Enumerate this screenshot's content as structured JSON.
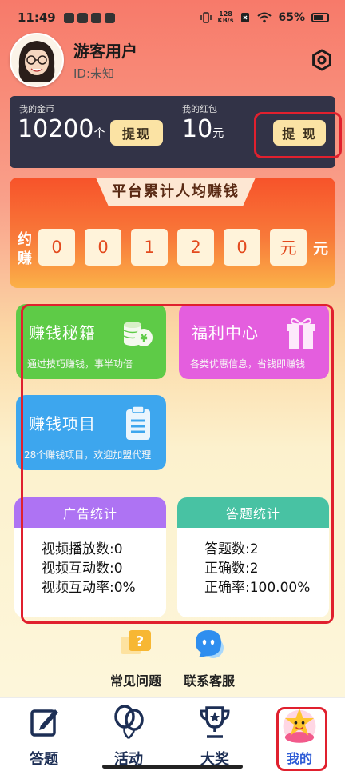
{
  "status_bar": {
    "time": "11:49",
    "net_speed_value": "128",
    "net_speed_unit": "KB/s",
    "battery": "65%"
  },
  "profile": {
    "username": "游客用户",
    "user_id": "ID:未知"
  },
  "wallet": {
    "coins_label": "我的金币",
    "coins_amount": "10200",
    "coins_unit": "个",
    "coins_withdraw": "提现",
    "redpacket_label": "我的红包",
    "redpacket_amount": "10",
    "redpacket_unit": "元",
    "redpacket_withdraw": "提 现"
  },
  "earnings": {
    "title": "平台累计人均赚钱",
    "side_label_1": "约",
    "side_label_2": "赚",
    "digits": [
      "0",
      "0",
      "1",
      "2",
      "0",
      "元"
    ],
    "tail": "元"
  },
  "tiles": {
    "earn_tips": {
      "title": "赚钱秘籍",
      "subtitle": "通过技巧赚钱，事半功倍"
    },
    "welfare": {
      "title": "福利中心",
      "subtitle": "各类优惠信息，省钱即赚钱"
    },
    "projects": {
      "title": "赚钱项目",
      "subtitle": "28个赚钱项目，欢迎加盟代理"
    }
  },
  "ad_stats": {
    "header": "广告统计",
    "rows": [
      "视频播放数:0",
      "视频互动数:0",
      "视频互动率:0%"
    ]
  },
  "quiz_stats": {
    "header": "答题统计",
    "rows": [
      "答题数:2",
      "正确数:2",
      "正确率:100.00%"
    ]
  },
  "help": {
    "faq": "常见问题",
    "support": "联系客服"
  },
  "tabs": [
    "答题",
    "活动",
    "大奖",
    "我的"
  ],
  "colors": {
    "wallet_bg": "#323347",
    "withdraw_btn": "#fbe3a4",
    "tile_green": "#5ecb47",
    "tile_pink": "#e45ede",
    "tile_blue": "#3da6ee",
    "ad_header": "#ae73f3",
    "quiz_header": "#48c2a3",
    "highlight_red": "#e0202e"
  }
}
